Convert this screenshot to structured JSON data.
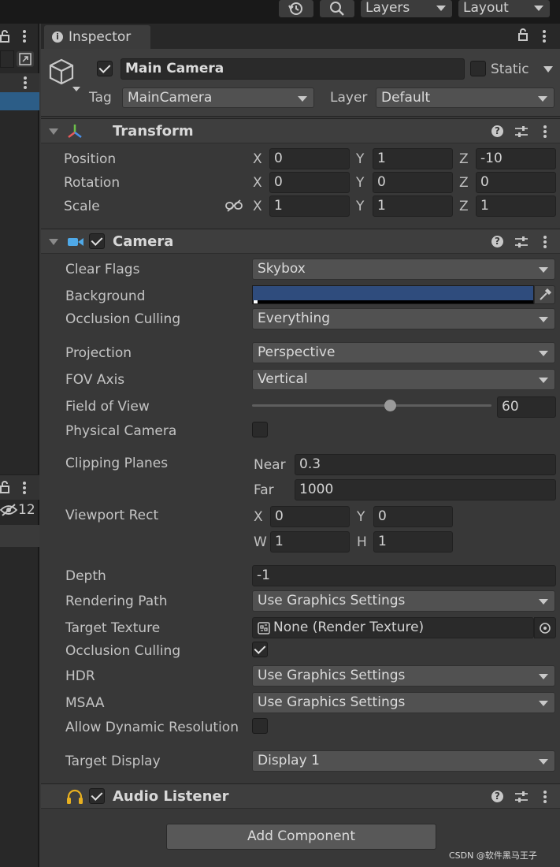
{
  "toolbar": {
    "layers_label": "Layers",
    "layout_label": "Layout"
  },
  "left_panel": {
    "hidden_count": "12"
  },
  "inspector": {
    "tab_label": "Inspector"
  },
  "gameobject": {
    "name": "Main Camera",
    "static_label": "Static",
    "tag_label": "Tag",
    "tag_value": "MainCamera",
    "layer_label": "Layer",
    "layer_value": "Default"
  },
  "transform": {
    "title": "Transform",
    "position": {
      "label": "Position",
      "x": "0",
      "y": "1",
      "z": "-10"
    },
    "rotation": {
      "label": "Rotation",
      "x": "0",
      "y": "0",
      "z": "0"
    },
    "scale": {
      "label": "Scale",
      "x": "1",
      "y": "1",
      "z": "1"
    },
    "axes": {
      "x": "X",
      "y": "Y",
      "z": "Z"
    }
  },
  "camera": {
    "title": "Camera",
    "clear_flags": {
      "label": "Clear Flags",
      "value": "Skybox"
    },
    "background": {
      "label": "Background",
      "color": "#2f4c7d"
    },
    "occlusion_mask": {
      "label": "Occlusion Culling",
      "value": "Everything"
    },
    "projection": {
      "label": "Projection",
      "value": "Perspective"
    },
    "fov_axis": {
      "label": "FOV Axis",
      "value": "Vertical"
    },
    "field_of_view": {
      "label": "Field of View",
      "value": "60",
      "slider_fraction": 0.58
    },
    "physical_camera": {
      "label": "Physical Camera"
    },
    "clipping_planes": {
      "label": "Clipping Planes",
      "near_label": "Near",
      "near_value": "0.3",
      "far_label": "Far",
      "far_value": "1000"
    },
    "viewport_rect": {
      "label": "Viewport Rect",
      "x_label": "X",
      "x": "0",
      "y_label": "Y",
      "y": "0",
      "w_label": "W",
      "w": "1",
      "h_label": "H",
      "h": "1"
    },
    "depth": {
      "label": "Depth",
      "value": "-1"
    },
    "rendering_path": {
      "label": "Rendering Path",
      "value": "Use Graphics Settings"
    },
    "target_texture": {
      "label": "Target Texture",
      "value": "None (Render Texture)"
    },
    "occlusion_culling": {
      "label": "Occlusion Culling"
    },
    "hdr": {
      "label": "HDR",
      "value": "Use Graphics Settings"
    },
    "msaa": {
      "label": "MSAA",
      "value": "Use Graphics Settings"
    },
    "dynamic_resolution": {
      "label": "Allow Dynamic Resolution"
    },
    "target_display": {
      "label": "Target Display",
      "value": "Display 1"
    }
  },
  "audio_listener": {
    "title": "Audio Listener"
  },
  "add_component_label": "Add Component",
  "watermark": "CSDN @软件黑马王子"
}
